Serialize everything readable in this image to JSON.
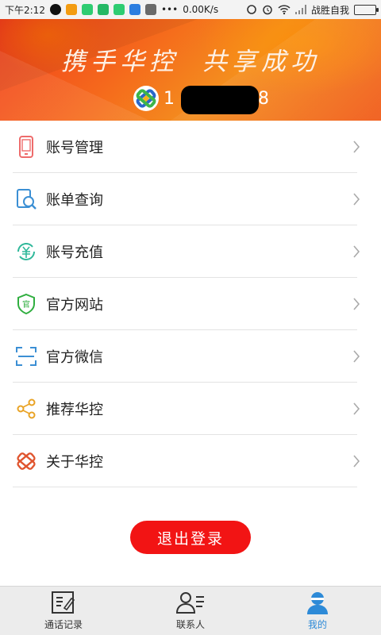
{
  "status_bar": {
    "time": "下午2:12",
    "speed": "0.00K/s",
    "carrier": "战胜自我"
  },
  "header": {
    "slogan_left": "携手华控",
    "slogan_right": "共享成功",
    "account_prefix": "1",
    "account_suffix": "8"
  },
  "menu": {
    "items": [
      {
        "label": "账号管理",
        "icon": "phone-icon"
      },
      {
        "label": "账单查询",
        "icon": "bill-search-icon"
      },
      {
        "label": "账号充值",
        "icon": "recharge-icon"
      },
      {
        "label": "官方网站",
        "icon": "shield-icon"
      },
      {
        "label": "官方微信",
        "icon": "scan-icon"
      },
      {
        "label": "推荐华控",
        "icon": "share-icon"
      },
      {
        "label": "关于华控",
        "icon": "about-logo-icon"
      }
    ]
  },
  "logout_label": "退出登录",
  "tabs": [
    {
      "label": "通话记录",
      "icon": "call-log-icon"
    },
    {
      "label": "联系人",
      "icon": "contacts-icon"
    },
    {
      "label": "我的",
      "icon": "profile-icon"
    }
  ],
  "colors": {
    "accent": "#f21414",
    "tab_active": "#2d8ad7"
  }
}
